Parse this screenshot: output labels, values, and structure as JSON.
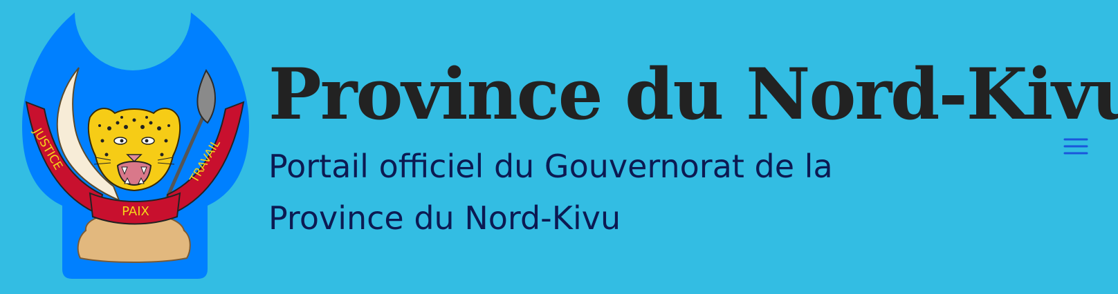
{
  "header": {
    "site_title": "Province du Nord-Kivu",
    "tagline": "Portail officiel du Gouvernorat de la Province du Nord-Kivu",
    "menu_icon": "hamburger-menu-icon"
  },
  "emblem": {
    "motto_left": "JUSTICE",
    "motto_center": "PAIX",
    "motto_right": "TRAVAIL"
  },
  "colors": {
    "background": "#33bde3",
    "title": "#222222",
    "tagline": "#0c1a52",
    "emblem_blue": "#0080ff",
    "ribbon_red": "#c8102e",
    "menu_icon": "#1a56db"
  }
}
